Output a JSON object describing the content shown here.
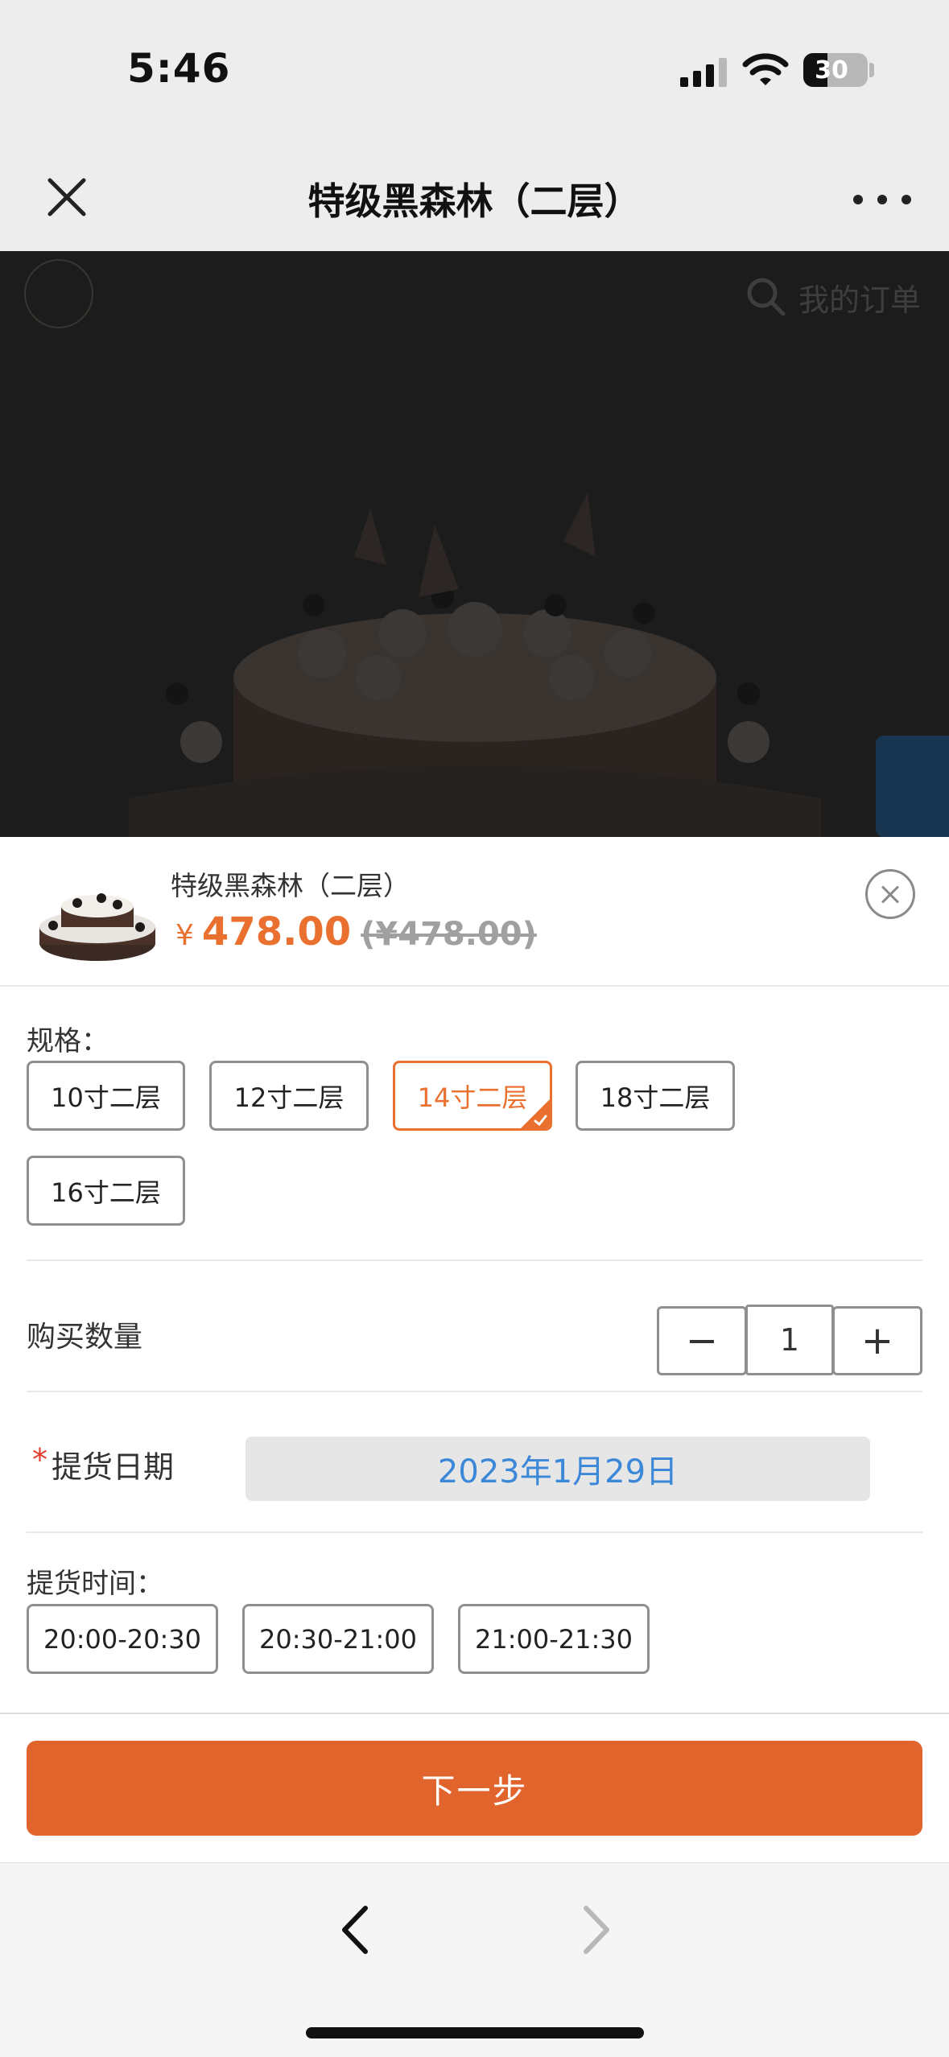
{
  "status_bar": {
    "time": "5:46",
    "battery_level": "30",
    "icons": [
      "signal-icon",
      "wifi-icon",
      "battery-icon"
    ]
  },
  "nav": {
    "title": "特级黑森林（二层）",
    "close_icon": "close-icon",
    "more_icon": "more-dots-icon"
  },
  "hero": {
    "orders_link": "我的订单",
    "search_icon": "search-icon",
    "service_icon": "customer-service-icon"
  },
  "product": {
    "name": "特级黑森林（二层）",
    "currency": "¥",
    "price": "478.00",
    "original_price": "(¥478.00)"
  },
  "spec": {
    "label": "规格：",
    "options": [
      "10寸二层",
      "12寸二层",
      "14寸二层",
      "18寸二层",
      "16寸二层"
    ],
    "selected": "14寸二层"
  },
  "quantity": {
    "label": "购买数量",
    "minus": "−",
    "plus": "+",
    "value": "1"
  },
  "pickup_date": {
    "required_mark": "*",
    "label": "提货日期",
    "value": "2023年1月29日"
  },
  "pickup_time": {
    "label": "提货时间：",
    "options": [
      "20:00-20:30",
      "20:30-21:00",
      "21:00-21:30"
    ]
  },
  "next_button": "下一步",
  "colors": {
    "accent": "#e2642d",
    "price": "#e9702f",
    "date_text": "#3b87d8",
    "required": "#e23b2d"
  }
}
